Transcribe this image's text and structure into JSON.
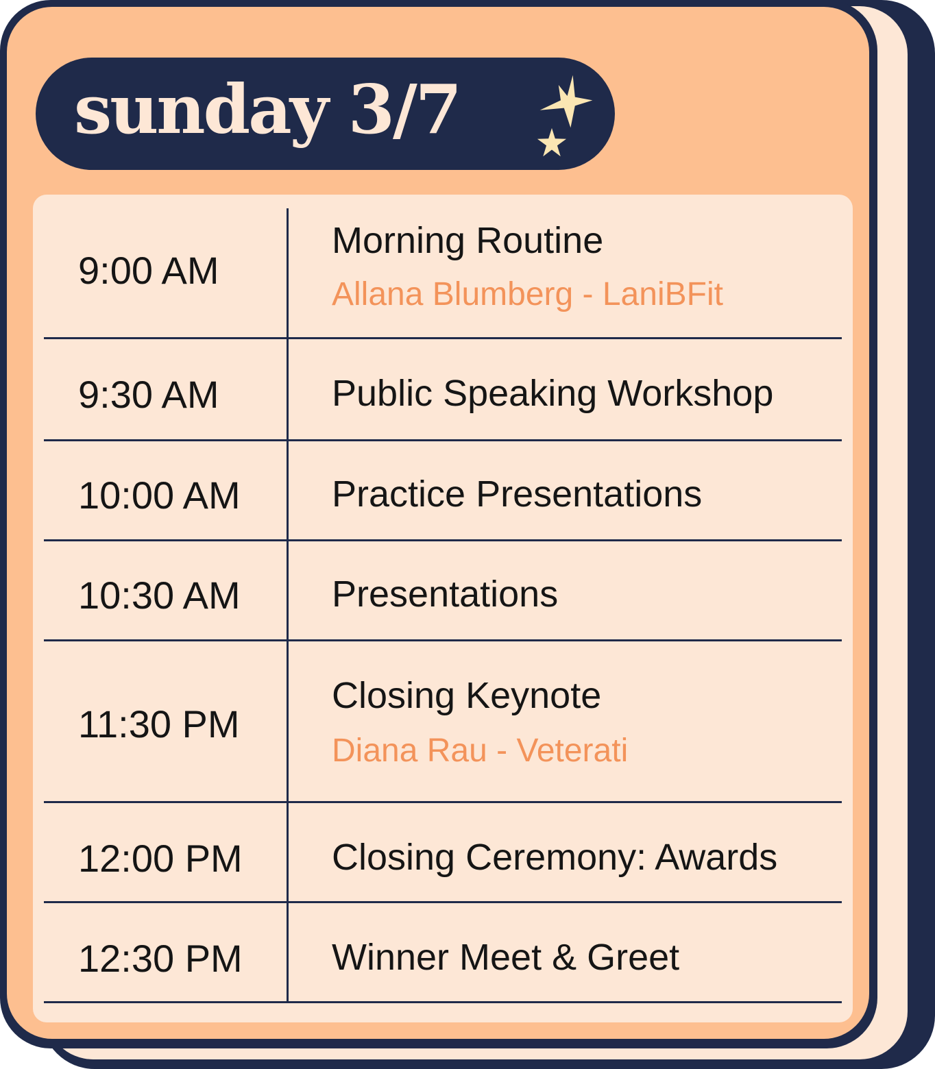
{
  "header": {
    "title": "sunday 3/7"
  },
  "colors": {
    "navy": "#1f2a4a",
    "peach": "#fdbf90",
    "cream": "#fde7d6",
    "speaker_orange": "#f3935a",
    "star": "#fbe6b3"
  },
  "icons": [
    "star-icon",
    "star-icon"
  ],
  "schedule": [
    {
      "time": "9:00 AM",
      "event": "Morning Routine",
      "speaker": "Allana Blumberg - LaniBFit"
    },
    {
      "time": "9:30 AM",
      "event": "Public Speaking Workshop"
    },
    {
      "time": "10:00 AM",
      "event": "Practice Presentations"
    },
    {
      "time": "10:30 AM",
      "event": "Presentations"
    },
    {
      "time": "11:30 PM",
      "event": "Closing Keynote",
      "speaker": "Diana Rau - Veterati"
    },
    {
      "time": "12:00 PM",
      "event": "Closing Ceremony: Awards"
    },
    {
      "time": "12:30 PM",
      "event": "Winner Meet & Greet"
    }
  ]
}
